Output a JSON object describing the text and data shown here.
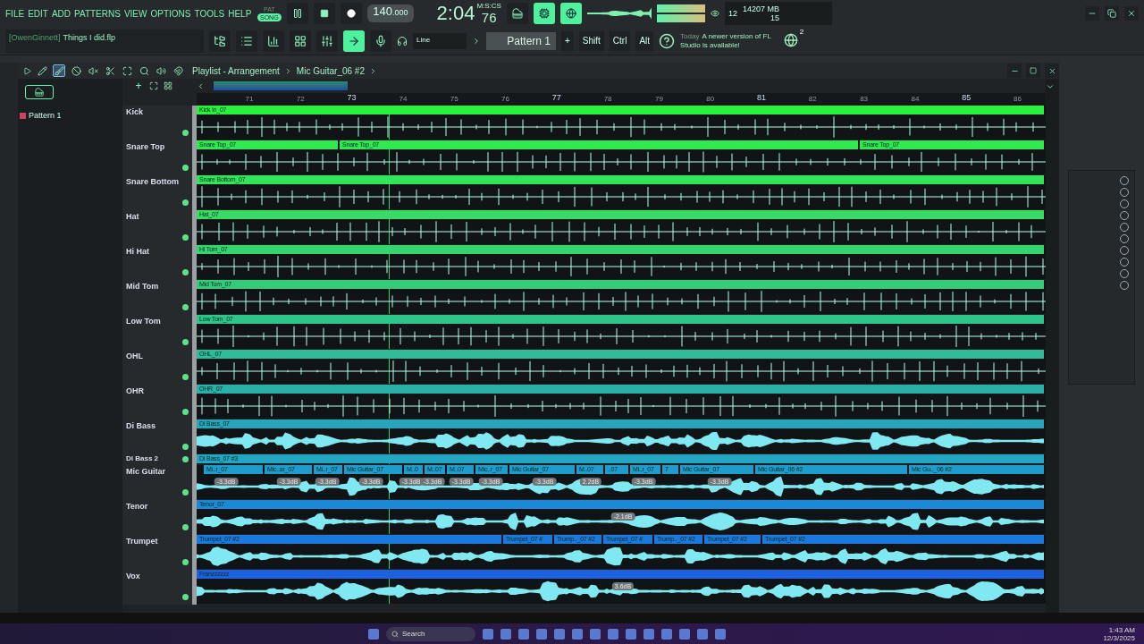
{
  "menu": [
    "FILE",
    "EDIT",
    "ADD",
    "PATTERNS",
    "VIEW",
    "OPTIONS",
    "TOOLS",
    "HELP"
  ],
  "transport": {
    "pat_label": "PAT",
    "song_label": "SONG",
    "song_mode": true,
    "tempo": "140",
    "tempo_fraction": ".000"
  },
  "clock": {
    "time": "2:04",
    "centiseconds": "76",
    "unit": "M:S:CS"
  },
  "view_buttons": [
    {
      "selected": false
    },
    {
      "selected": true
    },
    {
      "selected": true
    }
  ],
  "monitor": {
    "cpu": "12",
    "memory": "14207 MB",
    "polyphony": "15"
  },
  "project": {
    "user": "[OwenGinnett]",
    "file": "Things I did.flp"
  },
  "window_buttons": [
    {
      "selected": false
    },
    {
      "selected": false
    },
    {
      "selected": false
    },
    {
      "selected": false
    },
    {
      "selected": false
    },
    {
      "selected": true
    },
    {
      "selected": false
    }
  ],
  "snap": "Line",
  "pattern": "Pattern 1",
  "pattern_add": "+",
  "modifiers": [
    "Shift",
    "Ctrl",
    "Alt"
  ],
  "news": {
    "date": "Today",
    "message": "A newer version of FL Studio is available!",
    "count": "2"
  },
  "playlist": {
    "title": "Playlist - Arrangement",
    "breadcrumb": "Mic Guitar_06 #2",
    "tools": [
      {
        "selected": false
      },
      {
        "selected": true
      },
      {
        "selected": false
      },
      {
        "selected": false
      },
      {
        "selected": false
      },
      {
        "selected": false
      },
      {
        "selected": false
      },
      {
        "selected": false
      },
      {
        "selected": false
      }
    ],
    "patterns": [
      {
        "label": "Pattern 1",
        "selected": false
      }
    ],
    "add_track": "+",
    "ruler": [
      "71",
      "72",
      "73",
      "74",
      "75",
      "76",
      "77",
      "78",
      "79",
      "80",
      "81",
      "82",
      "83",
      "84",
      "85",
      "86"
    ],
    "tracks": [
      {
        "name": "Kick",
        "kind": "audio",
        "color": "#2af040",
        "enabled": true,
        "clips": [
          "Kick in_07"
        ]
      },
      {
        "name": "Snare Top",
        "kind": "audio",
        "color": "#2eea50",
        "enabled": true,
        "clips": [
          "Snare Top_07",
          "Snare Top_07",
          "Snare Top_07"
        ]
      },
      {
        "name": "Snare Bottom",
        "kind": "audio",
        "color": "#33e35a",
        "enabled": true,
        "clips": [
          "Snare Bottom_07"
        ]
      },
      {
        "name": "Hat",
        "kind": "audio",
        "color": "#36dc64",
        "enabled": true,
        "clips": [
          "Hat_07"
        ]
      },
      {
        "name": "Hi Hat",
        "kind": "audio",
        "color": "#36d46e",
        "enabled": true,
        "clips": [
          "Hi Tom_07"
        ]
      },
      {
        "name": "Mid Tom",
        "kind": "audio",
        "color": "#33cc7a",
        "enabled": true,
        "clips": [
          "Mid Tom_07"
        ]
      },
      {
        "name": "Low Tom",
        "kind": "audio",
        "color": "#2fc489",
        "enabled": true,
        "clips": [
          "Low Tom_07"
        ]
      },
      {
        "name": "OHL",
        "kind": "audio",
        "color": "#2dbb98",
        "enabled": true,
        "clips": [
          "OHL_07"
        ]
      },
      {
        "name": "OHR",
        "kind": "audio",
        "color": "#2ab0a6",
        "enabled": true,
        "clips": [
          "OHR_07"
        ]
      },
      {
        "name": "Di Bass",
        "kind": "audio",
        "color": "#25a6bc",
        "enabled": true,
        "clips": [
          "Di Bass_07"
        ]
      },
      {
        "name": "Di Bass 2",
        "kind": "slim",
        "color": "#22a6c4",
        "enabled": true,
        "clips": [
          "Di Bass_07 #3"
        ]
      },
      {
        "name": "Mic Guitar",
        "kind": "audio",
        "color": "#1e9ccc",
        "enabled": true,
        "clips": [
          "Mi..r_07",
          "Mic..ar_07",
          "Mi..r_07",
          "Mic Guitar_07",
          "M..0",
          "M..07",
          "M..07",
          "Mic..r_07",
          "Mic Guitar_07",
          "M..07",
          "..07",
          "Mi..r_07",
          "7",
          "Mic Guitar_07",
          "Mic Guitar_06 #2",
          "Mic Gu.._06 #2"
        ],
        "badges": [
          "-3.3dB",
          "-3.3dB",
          "-3.3dB",
          "-3.3dB",
          "-3.3dB",
          "-3.3dB",
          "-3.3dB",
          "-3.3dB",
          "-3.3dB",
          "2.2dB",
          "-3.3dB",
          "-3.3dB"
        ]
      },
      {
        "name": "Tenor",
        "kind": "audio",
        "color": "#1a8ad8",
        "enabled": true,
        "clips": [
          "Tenor_07"
        ],
        "badges": [
          "-2.1dB"
        ]
      },
      {
        "name": "Trumpet",
        "kind": "audio",
        "color": "#1b78dc",
        "enabled": true,
        "clips": [
          "Trumpet_07 #2",
          "Trumpet_07 #",
          "Trump.._07 #2",
          "Trumpet_07 #",
          "Trump.._07 #2",
          "Trumpet_07 #2",
          "Trumpet_07 #2"
        ]
      },
      {
        "name": "Vox",
        "kind": "audio",
        "color": "#1c62e0",
        "enabled": true,
        "clips": [
          "Franzzzzzz"
        ],
        "badges": [
          "3.6dB"
        ]
      }
    ]
  },
  "taskbar": {
    "search": "Search",
    "time": "1:43 AM",
    "date": "12/3/2025"
  }
}
